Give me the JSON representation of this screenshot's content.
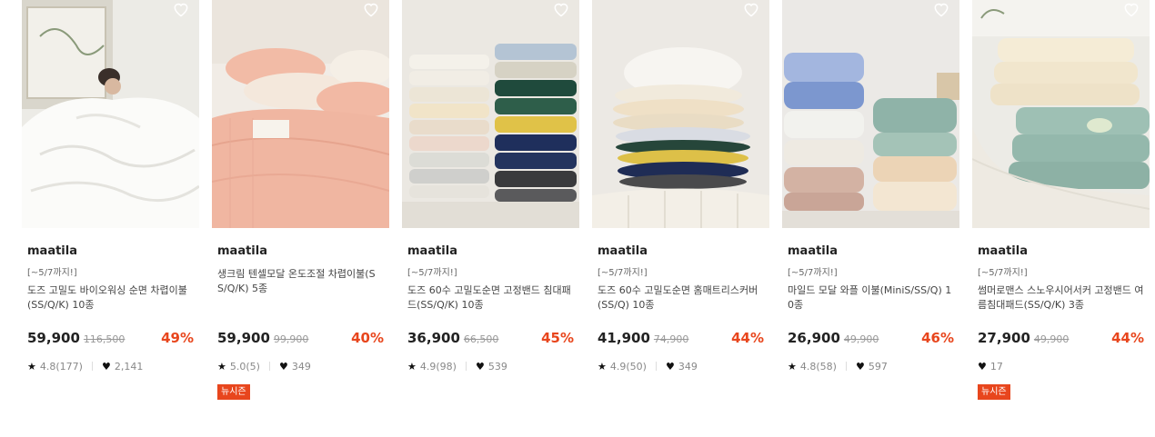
{
  "products": [
    {
      "brand": "maatila",
      "promo": "[~5/7까지!]",
      "title": "도즈 고밀도 바이오워싱 순면 차렵이불(SS/Q/K) 10종",
      "price": "59,900",
      "original_price": "116,500",
      "discount": "49%",
      "rating": "4.8(177)",
      "likes": "2,141",
      "badge": ""
    },
    {
      "brand": "maatila",
      "promo": "",
      "title": "생크림 텐셀모달 온도조절 차렵이불(SS/Q/K) 5종",
      "price": "59,900",
      "original_price": "99,900",
      "discount": "40%",
      "rating": "5.0(5)",
      "likes": "349",
      "badge": "뉴시즌"
    },
    {
      "brand": "maatila",
      "promo": "[~5/7까지!]",
      "title": "도즈 60수 고밀도순면 고정밴드 침대패드(SS/Q/K) 10종",
      "price": "36,900",
      "original_price": "66,500",
      "discount": "45%",
      "rating": "4.9(98)",
      "likes": "539",
      "badge": ""
    },
    {
      "brand": "maatila",
      "promo": "[~5/7까지!]",
      "title": "도즈 60수 고밀도순면 홈매트리스커버(SS/Q) 10종",
      "price": "41,900",
      "original_price": "74,900",
      "discount": "44%",
      "rating": "4.9(50)",
      "likes": "349",
      "badge": ""
    },
    {
      "brand": "maatila",
      "promo": "[~5/7까지!]",
      "title": "마일드 모달 와플 이불(MiniS/SS/Q) 10종",
      "price": "26,900",
      "original_price": "49,900",
      "discount": "46%",
      "rating": "4.8(58)",
      "likes": "597",
      "badge": ""
    },
    {
      "brand": "maatila",
      "promo": "[~5/7까지!]",
      "title": "썸머로맨스 스노우시어서커 고정밴드 여름침대패드(SS/Q/K) 3종",
      "price": "27,900",
      "original_price": "49,900",
      "discount": "44%",
      "rating": "",
      "likes": "17",
      "badge": "뉴시즌"
    }
  ],
  "icons": {
    "wishlist": "heart-outline-icon",
    "star": "star-icon",
    "like": "heart-icon"
  },
  "colors": {
    "discount": "#e8461d",
    "badge_bg": "#e8461d"
  }
}
